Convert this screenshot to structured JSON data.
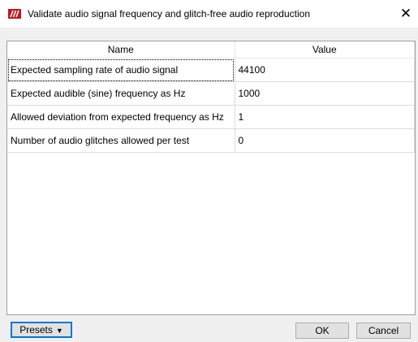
{
  "window": {
    "title": "Validate audio signal frequency and glitch-free audio reproduction",
    "close_glyph": "✕"
  },
  "colors": {
    "app_icon": "#c4151c",
    "focus": "#0078d7"
  },
  "table": {
    "headers": [
      "Name",
      "Value"
    ],
    "rows": [
      {
        "name": "Expected sampling rate of audio signal",
        "value": "44100"
      },
      {
        "name": "Expected audible (sine) frequency as Hz",
        "value": "1000"
      },
      {
        "name": "Allowed deviation from expected frequency as Hz",
        "value": "1"
      },
      {
        "name": "Number of audio glitches allowed per test",
        "value": "0"
      }
    ]
  },
  "buttons": {
    "presets": "Presets",
    "presets_arrow": "▼",
    "ok": "OK",
    "cancel": "Cancel"
  }
}
